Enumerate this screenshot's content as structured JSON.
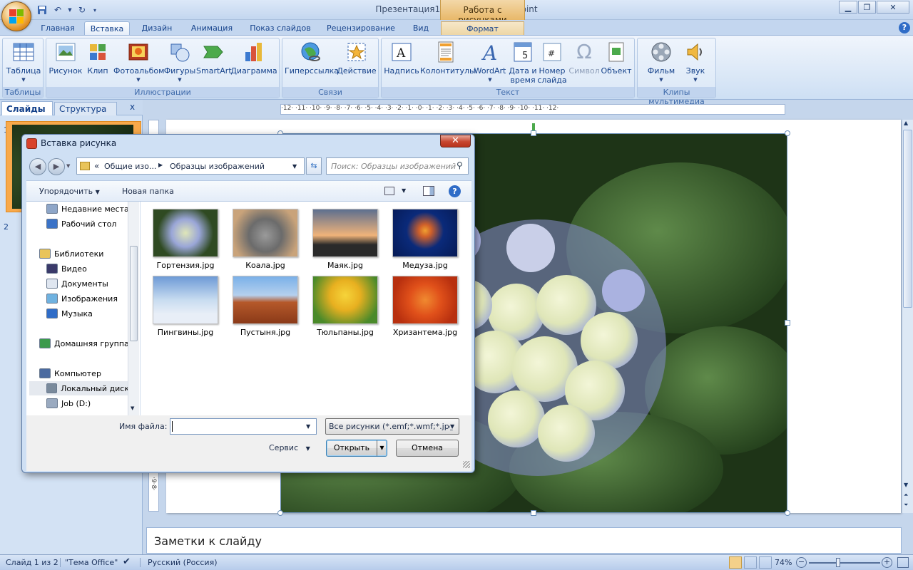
{
  "window": {
    "title": "Презентация1 - Microsoft PowerPoint",
    "context_tab": "Работа с рисунками"
  },
  "tabs": [
    "Главная",
    "Вставка",
    "Дизайн",
    "Анимация",
    "Показ слайдов",
    "Рецензирование",
    "Вид",
    "Формат"
  ],
  "active_tab": "Вставка",
  "ribbon": {
    "groups": {
      "tables": "Таблицы",
      "illustrations": "Иллюстрации",
      "links": "Связи",
      "text": "Текст",
      "media": "Клипы мультимедиа"
    },
    "buttons": {
      "table": "Таблица",
      "picture": "Рисунок",
      "clip": "Клип",
      "photoalbum": "Фотоальбом",
      "shapes": "Фигуры",
      "smartart": "SmartArt",
      "chart": "Диаграмма",
      "hyperlink": "Гиперссылка",
      "action": "Действие",
      "textbox": "Надпись",
      "headerfooter": "Колонтитулы",
      "wordart": "WordArt",
      "datetime_1": "Дата и",
      "datetime_2": "время",
      "slidenum_1": "Номер",
      "slidenum_2": "слайда",
      "symbol": "Символ",
      "object": "Объект",
      "movie": "Фильм",
      "sound": "Звук"
    }
  },
  "left_panel": {
    "tab_slides": "Слайды",
    "tab_outline": "Структура",
    "close": "x",
    "slide_numbers": [
      "1",
      "2"
    ]
  },
  "ruler": "·12· ·11· ·10· ·9· ·8· ·7· ·6· ·5· ·4· ·3· ·2· ·1· ·0· ·1· ·2· ·3· ·4· ·5· ·6· ·7· ·8· ·9· ·10· ·11· ·12·",
  "ruler_v": "·9·8·",
  "notes_placeholder": "Заметки к слайду",
  "status": {
    "slide": "Слайд 1 из 2",
    "theme": "\"Тема Office\"",
    "language": "Русский (Россия)",
    "zoom": "74%"
  },
  "dialog": {
    "title": "Вставка рисунка",
    "breadcrumb_prefix": "«",
    "breadcrumb_1": "Общие изо...",
    "breadcrumb_2": "Образцы изображений",
    "search_placeholder": "Поиск: Образцы изображений",
    "organize": "Упорядочить",
    "new_folder": "Новая папка",
    "nav": [
      {
        "label": "Недавние места",
        "indent": 1
      },
      {
        "label": "Рабочий стол",
        "indent": 1
      },
      {
        "label": "Библиотеки",
        "indent": 0
      },
      {
        "label": "Видео",
        "indent": 1
      },
      {
        "label": "Документы",
        "indent": 1
      },
      {
        "label": "Изображения",
        "indent": 1
      },
      {
        "label": "Музыка",
        "indent": 1
      },
      {
        "label": "Домашняя группа",
        "indent": 0
      },
      {
        "label": "Компьютер",
        "indent": 0
      },
      {
        "label": "Локальный диск",
        "indent": 1
      },
      {
        "label": "Job (D:)",
        "indent": 1
      }
    ],
    "files": [
      {
        "name": "Гортензия.jpg"
      },
      {
        "name": "Коала.jpg"
      },
      {
        "name": "Маяк.jpg"
      },
      {
        "name": "Медуза.jpg"
      },
      {
        "name": "Пингвины.jpg"
      },
      {
        "name": "Пустыня.jpg"
      },
      {
        "name": "Тюльпаны.jpg"
      },
      {
        "name": "Хризантема.jpg"
      }
    ],
    "filename_label": "Имя файла:",
    "filename_value": "",
    "filetype": "Все рисунки (*.emf;*.wmf;*.jpg",
    "tools": "Сервис",
    "open": "Открыть",
    "cancel": "Отмена"
  },
  "colors": {
    "accent": "#15428b",
    "context_tab": "#e8b869"
  }
}
